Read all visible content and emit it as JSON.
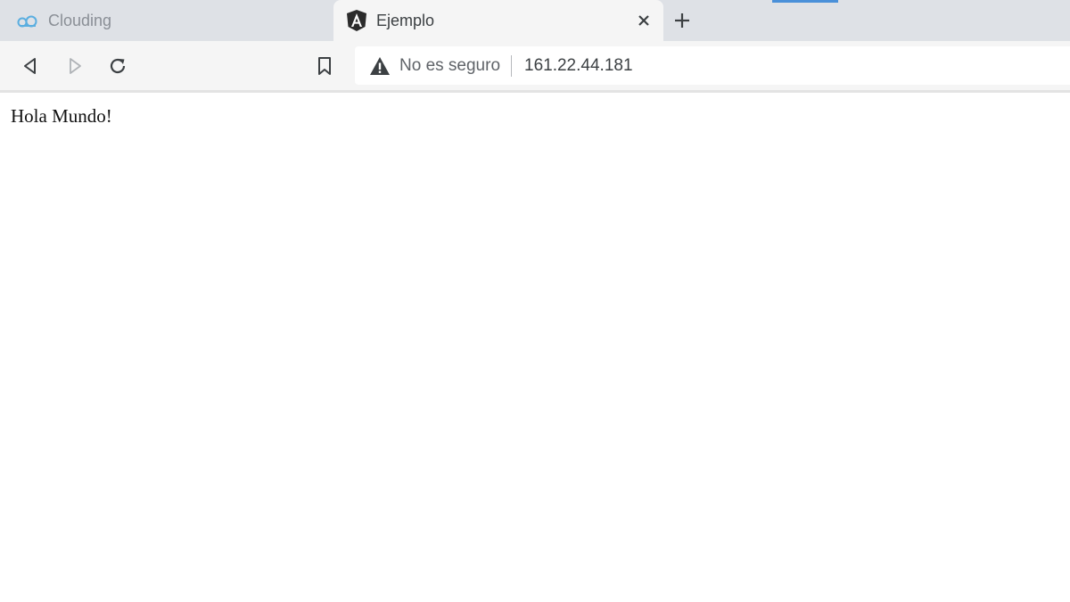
{
  "tabs": [
    {
      "title": "Clouding",
      "icon": "cloud-icon",
      "active": false
    },
    {
      "title": "Ejemplo",
      "icon": "angular-icon",
      "active": true
    }
  ],
  "toolbar": {
    "back_icon": "back-arrow-icon",
    "forward_icon": "forward-arrow-icon",
    "reload_icon": "reload-icon",
    "bookmark_icon": "bookmark-icon"
  },
  "omnibox": {
    "security_icon": "warning-icon",
    "security_text": "No es seguro",
    "url": "161.22.44.181"
  },
  "page": {
    "text": "Hola Mundo!"
  },
  "colors": {
    "tabstrip": "#dee1e6",
    "active_tab": "#f5f5f5",
    "cloud_icon": "#5aaee0",
    "accent": "#4a90d9"
  }
}
